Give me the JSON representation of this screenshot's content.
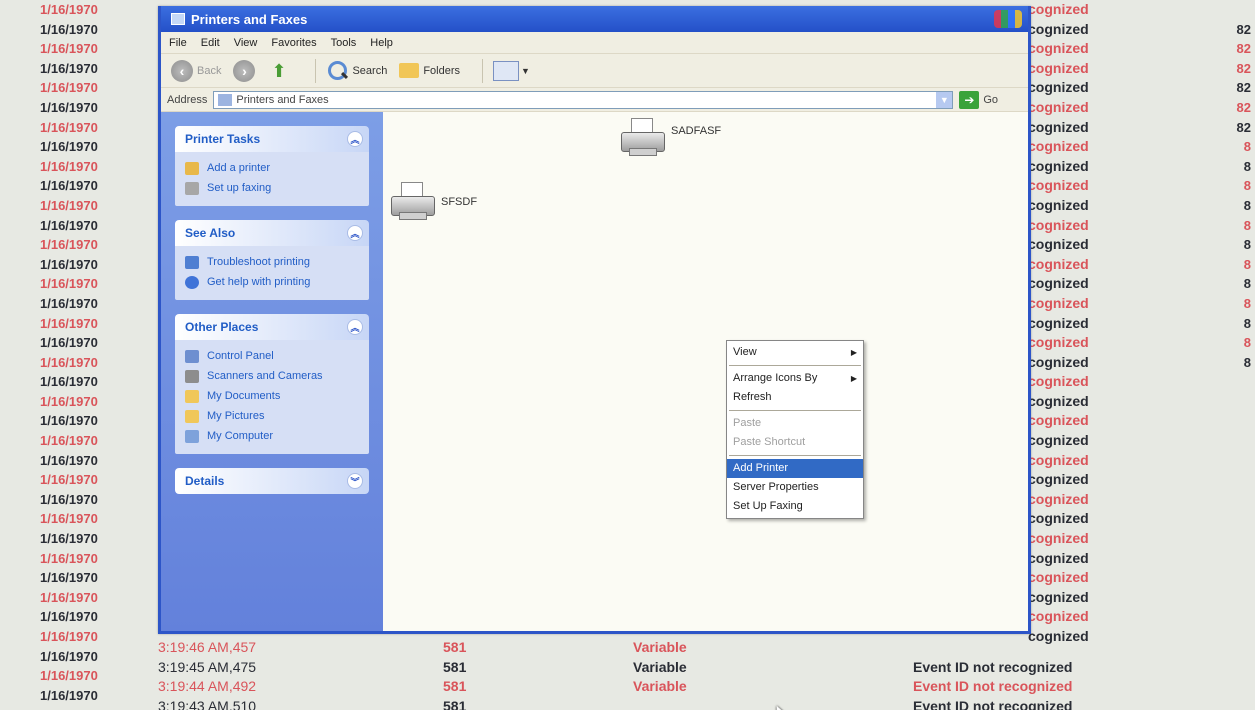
{
  "background_log": {
    "dates": [
      {
        "text": "1/16/1970",
        "tone": "red"
      },
      {
        "text": "1/16/1970",
        "tone": "dark"
      },
      {
        "text": "1/16/1970",
        "tone": "red"
      },
      {
        "text": "1/16/1970",
        "tone": "dark"
      },
      {
        "text": "1/16/1970",
        "tone": "red"
      },
      {
        "text": "1/16/1970",
        "tone": "dark"
      },
      {
        "text": "1/16/1970",
        "tone": "red"
      },
      {
        "text": "1/16/1970",
        "tone": "dark"
      },
      {
        "text": "1/16/1970",
        "tone": "red"
      },
      {
        "text": "1/16/1970",
        "tone": "dark"
      },
      {
        "text": "1/16/1970",
        "tone": "red"
      },
      {
        "text": "1/16/1970",
        "tone": "dark"
      },
      {
        "text": "1/16/1970",
        "tone": "red"
      },
      {
        "text": "1/16/1970",
        "tone": "dark"
      },
      {
        "text": "1/16/1970",
        "tone": "red"
      },
      {
        "text": "1/16/1970",
        "tone": "dark"
      },
      {
        "text": "1/16/1970",
        "tone": "red"
      },
      {
        "text": "1/16/1970",
        "tone": "dark"
      },
      {
        "text": "1/16/1970",
        "tone": "red"
      },
      {
        "text": "1/16/1970",
        "tone": "dark"
      },
      {
        "text": "1/16/1970",
        "tone": "red"
      },
      {
        "text": "1/16/1970",
        "tone": "dark"
      },
      {
        "text": "1/16/1970",
        "tone": "red"
      },
      {
        "text": "1/16/1970",
        "tone": "dark"
      },
      {
        "text": "1/16/1970",
        "tone": "red"
      },
      {
        "text": "1/16/1970",
        "tone": "dark"
      },
      {
        "text": "1/16/1970",
        "tone": "red"
      },
      {
        "text": "1/16/1970",
        "tone": "dark"
      },
      {
        "text": "1/16/1970",
        "tone": "red"
      },
      {
        "text": "1/16/1970",
        "tone": "dark"
      },
      {
        "text": "1/16/1970",
        "tone": "red"
      },
      {
        "text": "1/16/1970",
        "tone": "dark"
      },
      {
        "text": "1/16/1970",
        "tone": "red"
      },
      {
        "text": "1/16/1970",
        "tone": "dark"
      },
      {
        "text": "1/16/1970",
        "tone": "red"
      },
      {
        "text": "1/16/1970",
        "tone": "dark"
      }
    ],
    "right_column": [
      {
        "text": "cognized",
        "id": "",
        "tone": "red"
      },
      {
        "text": "cognized",
        "id": "82",
        "tone": "dark"
      },
      {
        "text": "cognized",
        "id": "82",
        "tone": "red"
      },
      {
        "text": "cognized",
        "id": "82",
        "tone": "red"
      },
      {
        "text": "cognized",
        "id": "82",
        "tone": "dark"
      },
      {
        "text": "cognized",
        "id": "82",
        "tone": "red"
      },
      {
        "text": "cognized",
        "id": "82",
        "tone": "dark"
      },
      {
        "text": "cognized",
        "id": "8",
        "tone": "red"
      },
      {
        "text": "cognized",
        "id": "8",
        "tone": "dark"
      },
      {
        "text": "cognized",
        "id": "8",
        "tone": "red"
      },
      {
        "text": "cognized",
        "id": "8",
        "tone": "dark"
      },
      {
        "text": "cognized",
        "id": "8",
        "tone": "red"
      },
      {
        "text": "cognized",
        "id": "8",
        "tone": "dark"
      },
      {
        "text": "cognized",
        "id": "8",
        "tone": "red"
      },
      {
        "text": "cognized",
        "id": "8",
        "tone": "dark"
      },
      {
        "text": "cognized",
        "id": "8",
        "tone": "red"
      },
      {
        "text": "cognized",
        "id": "8",
        "tone": "dark"
      },
      {
        "text": "cognized",
        "id": "8",
        "tone": "red"
      },
      {
        "text": "cognized",
        "id": "8",
        "tone": "dark"
      },
      {
        "text": "cognized",
        "id": "",
        "tone": "red"
      },
      {
        "text": "cognized",
        "id": "",
        "tone": "dark"
      },
      {
        "text": "cognized",
        "id": "",
        "tone": "red"
      },
      {
        "text": "cognized",
        "id": "",
        "tone": "dark"
      },
      {
        "text": "cognized",
        "id": "",
        "tone": "red"
      },
      {
        "text": "cognized",
        "id": "",
        "tone": "dark"
      },
      {
        "text": "cognized",
        "id": "",
        "tone": "red"
      },
      {
        "text": "cognized",
        "id": "",
        "tone": "dark"
      },
      {
        "text": "cognized",
        "id": "",
        "tone": "red"
      },
      {
        "text": "cognized",
        "id": "",
        "tone": "dark"
      },
      {
        "text": "cognized",
        "id": "",
        "tone": "red"
      },
      {
        "text": "cognized",
        "id": "",
        "tone": "dark"
      },
      {
        "text": "cognized",
        "id": "",
        "tone": "red"
      },
      {
        "text": "cognized",
        "id": "",
        "tone": "dark"
      }
    ],
    "bottom_rows": [
      {
        "time": "3:19:46 AM,457",
        "num": "581",
        "var": "Variable",
        "evt": "",
        "tone": "red"
      },
      {
        "time": "3:19:45 AM,475",
        "num": "581",
        "var": "Variable",
        "evt": "Event ID not recognized",
        "tone": "dark"
      },
      {
        "time": "3:19:44 AM,492",
        "num": "581",
        "var": "Variable",
        "evt": "Event ID not recognized",
        "tone": "red"
      },
      {
        "time": "3:19:43 AM,510",
        "num": "581",
        "var": "",
        "evt": "Event ID not recognized",
        "tone": "dark"
      }
    ]
  },
  "window": {
    "title": "Printers and Faxes",
    "menu": [
      "File",
      "Edit",
      "View",
      "Favorites",
      "Tools",
      "Help"
    ],
    "toolbar": {
      "back": "Back",
      "search": "Search",
      "folders": "Folders"
    },
    "address_label": "Address",
    "address_value": "Printers and Faxes",
    "go_label": "Go"
  },
  "taskpane": {
    "printer_tasks": {
      "title": "Printer Tasks",
      "items": [
        "Add a printer",
        "Set up faxing"
      ]
    },
    "see_also": {
      "title": "See Also",
      "items": [
        "Troubleshoot printing",
        "Get help with printing"
      ]
    },
    "other_places": {
      "title": "Other Places",
      "items": [
        "Control Panel",
        "Scanners and Cameras",
        "My Documents",
        "My Pictures",
        "My Computer"
      ]
    },
    "details": {
      "title": "Details"
    }
  },
  "printers": [
    {
      "name": "SADFASF"
    },
    {
      "name": "SFSDF"
    }
  ],
  "context_menu": {
    "items": [
      {
        "label": "View",
        "submenu": true,
        "state": "normal"
      },
      {
        "sep": true
      },
      {
        "label": "Arrange Icons By",
        "submenu": true,
        "state": "normal"
      },
      {
        "label": "Refresh",
        "submenu": false,
        "state": "normal"
      },
      {
        "sep": true
      },
      {
        "label": "Paste",
        "submenu": false,
        "state": "disabled"
      },
      {
        "label": "Paste Shortcut",
        "submenu": false,
        "state": "disabled"
      },
      {
        "sep": true
      },
      {
        "label": "Add Printer",
        "submenu": false,
        "state": "selected"
      },
      {
        "label": "Server Properties",
        "submenu": false,
        "state": "normal"
      },
      {
        "label": "Set Up Faxing",
        "submenu": false,
        "state": "normal"
      }
    ]
  }
}
